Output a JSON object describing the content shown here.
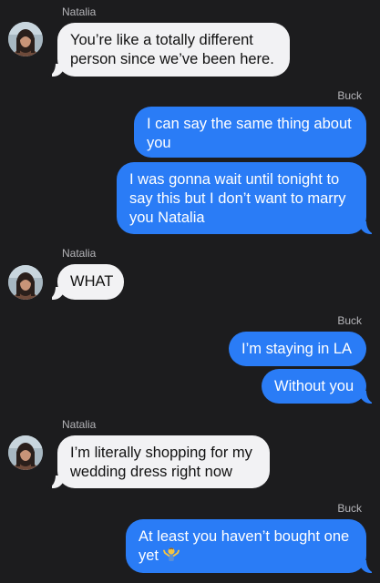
{
  "conversation": {
    "contact_name": "Natalia",
    "me_name": "Buck"
  },
  "messages": [
    {
      "from": "Natalia",
      "lines": [
        "You’re like a totally different",
        "person since we’ve been here."
      ]
    },
    {
      "from": "Buck",
      "lines": [
        "I can say the same thing about",
        "you"
      ]
    },
    {
      "from": "Buck",
      "lines": [
        "I was gonna wait until tonight to",
        "say this but I don’t want to marry",
        "you Natalia"
      ]
    },
    {
      "from": "Natalia",
      "lines": [
        "WHAT"
      ]
    },
    {
      "from": "Buck",
      "lines": [
        "I’m staying in LA"
      ]
    },
    {
      "from": "Buck",
      "lines": [
        "Without you"
      ]
    },
    {
      "from": "Natalia",
      "lines": [
        "I’m literally shopping for my",
        "wedding dress right now"
      ]
    },
    {
      "from": "Buck",
      "lines": [
        "At least you haven’t bought one",
        "yet"
      ],
      "trailing_icon": "shrug-emoji-icon"
    }
  ],
  "colors": {
    "background": "#1c1c1e",
    "incoming_bubble": "#f2f2f4",
    "outgoing_bubble": "#2a7cf6"
  }
}
